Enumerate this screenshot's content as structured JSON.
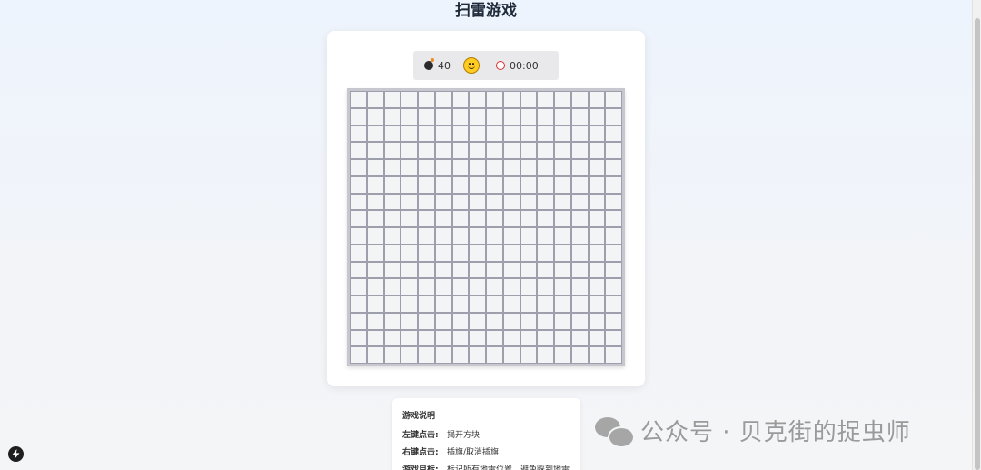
{
  "page": {
    "title": "扫雷游戏"
  },
  "status": {
    "mines_remaining": "40",
    "timer": "00:00",
    "face": "smile"
  },
  "board": {
    "rows": 16,
    "cols": 16,
    "state": "all-covered"
  },
  "instructions": {
    "heading": "游戏说明",
    "items": [
      {
        "key": "左键点击:",
        "desc": "揭开方块"
      },
      {
        "key": "右键点击:",
        "desc": "插旗/取消插旗"
      },
      {
        "key": "游戏目标:",
        "desc": "标记所有地雷位置，避免踩到地雷"
      }
    ]
  },
  "watermark": {
    "text": "公众号 · 贝克街的捉虫师"
  },
  "icons": {
    "mine": "bomb-icon",
    "timer": "alarm-clock-icon",
    "face": "smiley-face-icon",
    "bottom_left": "lightning-bolt-icon",
    "watermark": "wechat-icon"
  }
}
